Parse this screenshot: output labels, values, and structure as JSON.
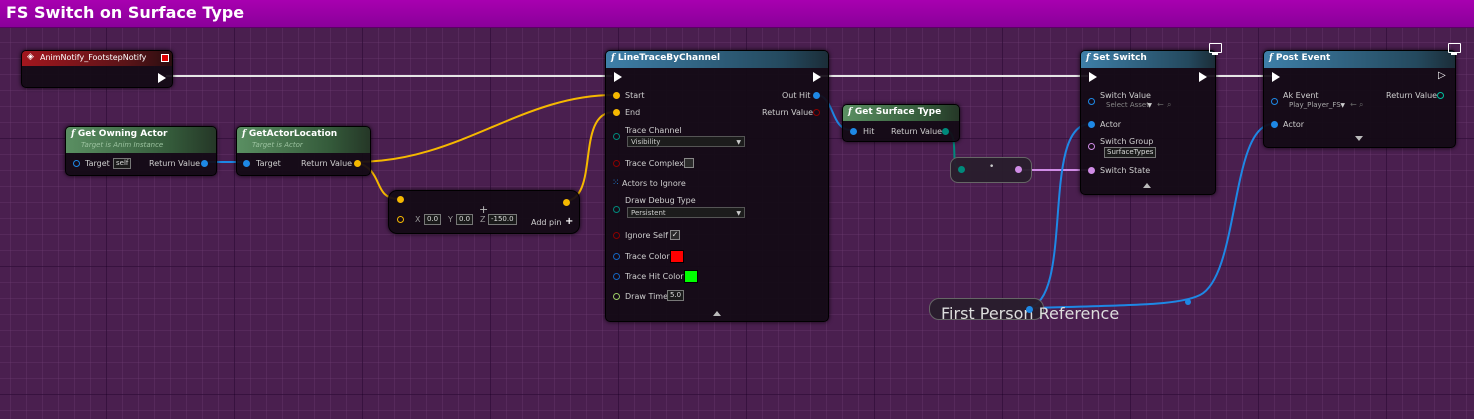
{
  "window": {
    "title": "FS Switch on Surface Type"
  },
  "colors": {
    "title_bar": "#a000aa",
    "background": "#4a1f4f",
    "exec_wire": "#e6e6e6",
    "object_pin": "#1e88e5",
    "vector_pin": "#f5b800",
    "struct_pin": "#00897b",
    "bool_pin": "#8b0000",
    "name_pin": "#d08ce6",
    "linear_color_pin": "#1565c0",
    "float_pin": "#9ccc65"
  },
  "event_node": {
    "title": "AnimNotify_FootstepNotify",
    "icon": "event-diamond-icon"
  },
  "get_owning_actor": {
    "title": "Get Owning Actor",
    "subtitle": "Target is Anim Instance",
    "target_label": "Target",
    "target_value": "self",
    "return_label": "Return Value"
  },
  "get_actor_location": {
    "title": "GetActorLocation",
    "subtitle": "Target is Actor",
    "target_label": "Target",
    "return_label": "Return Value"
  },
  "vector_add": {
    "x_label": "X",
    "x_value": "0.0",
    "y_label": "Y",
    "y_value": "0.0",
    "z_label": "Z",
    "z_value": "-150.0",
    "add_pin_label": "Add pin"
  },
  "line_trace": {
    "title": "LineTraceByChannel",
    "start_label": "Start",
    "end_label": "End",
    "trace_channel_label": "Trace Channel",
    "trace_channel_value": "Visibility",
    "trace_complex_label": "Trace Complex",
    "trace_complex_checked": false,
    "actors_to_ignore_label": "Actors to Ignore",
    "draw_debug_type_label": "Draw Debug Type",
    "draw_debug_type_value": "Persistent",
    "ignore_self_label": "Ignore Self",
    "ignore_self_checked": true,
    "trace_color_label": "Trace Color",
    "trace_color": "#ff0000",
    "trace_hit_color_label": "Trace Hit Color",
    "trace_hit_color": "#00ff00",
    "draw_time_label": "Draw Time",
    "draw_time_value": "5.0",
    "out_hit_label": "Out Hit",
    "return_label": "Return Value"
  },
  "get_surface_type": {
    "title": "Get Surface Type",
    "hit_label": "Hit",
    "return_label": "Return Value"
  },
  "set_switch": {
    "title": "Set Switch",
    "switch_value_label": "Switch Value",
    "switch_value_placeholder": "Select Asset",
    "actor_label": "Actor",
    "switch_group_label": "Switch Group",
    "switch_group_value": "SurfaceTypes",
    "switch_state_label": "Switch State"
  },
  "post_event": {
    "title": "Post Event",
    "ak_event_label": "Ak Event",
    "ak_event_value": "Play_Player_FS",
    "actor_label": "Actor",
    "return_label": "Return Value"
  },
  "first_person_ref": {
    "label": "First Person Reference"
  }
}
